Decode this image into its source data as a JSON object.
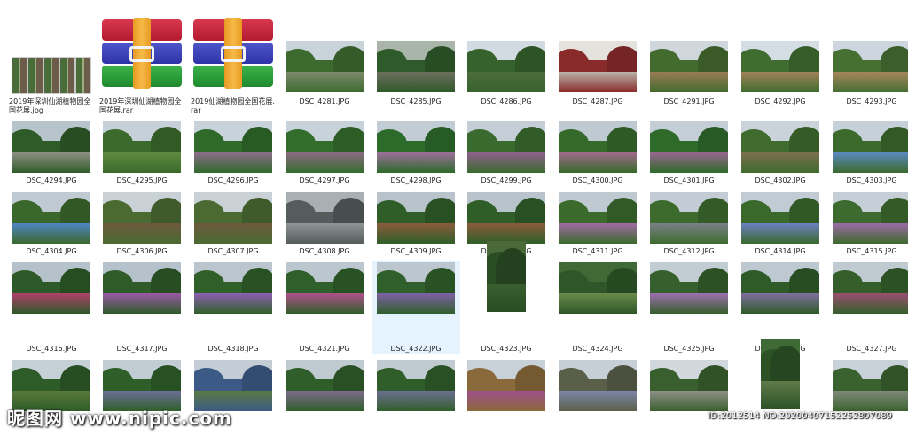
{
  "files": [
    {
      "type": "sheet",
      "name": "2019年深圳仙湖植物园全国花展.jpg"
    },
    {
      "type": "rar",
      "name": "2019年深圳仙湖植物园全国花展.rar"
    },
    {
      "type": "rar",
      "name": "2019仙湖植物园全国花展.rar"
    },
    {
      "type": "photo",
      "name": "DSC_4281.JPG",
      "sky": "#c9d3da",
      "tree": "#3d6b2f",
      "ground": "#7d8a6c"
    },
    {
      "type": "photo",
      "name": "DSC_4285.JPG",
      "sky": "#a9b5a8",
      "tree": "#2f5a2a",
      "ground": "#6e6f5e"
    },
    {
      "type": "photo",
      "name": "DSC_4286.JPG",
      "sky": "#d2dbe2",
      "tree": "#36632d",
      "ground": "#4f6d3c"
    },
    {
      "type": "photo",
      "name": "DSC_4287.JPG",
      "sky": "#e4e2dd",
      "tree": "#8a2b2b",
      "ground": "#b9b4aa"
    },
    {
      "type": "photo",
      "name": "DSC_4291.JPG",
      "sky": "#cfd6dc",
      "tree": "#446b2e",
      "ground": "#9b7c55"
    },
    {
      "type": "photo",
      "name": "DSC_4292.JPG",
      "sky": "#d5dde4",
      "tree": "#3f6c2f",
      "ground": "#a2815a"
    },
    {
      "type": "photo",
      "name": "DSC_4293.JPG",
      "sky": "#cdd6de",
      "tree": "#466f32",
      "ground": "#a8855c"
    },
    {
      "type": "photo",
      "name": "DSC_4294.JPG",
      "sky": "#b8c4cc",
      "tree": "#2f5b29",
      "ground": "#8d8f82"
    },
    {
      "type": "photo",
      "name": "DSC_4295.JPG",
      "sky": "#c5d0d8",
      "tree": "#3b6a2c",
      "ground": "#5f8a3e"
    },
    {
      "type": "photo",
      "name": "DSC_4296.JPG",
      "sky": "#c8d2da",
      "tree": "#2f6a2a",
      "ground": "#8c6d8a"
    },
    {
      "type": "photo",
      "name": "DSC_4297.JPG",
      "sky": "#c8d2da",
      "tree": "#336d2c",
      "ground": "#8b6a82"
    },
    {
      "type": "photo",
      "name": "DSC_4298.JPG",
      "sky": "#c2ccd4",
      "tree": "#2d6b2b",
      "ground": "#9c6f9a"
    },
    {
      "type": "photo",
      "name": "DSC_4299.JPG",
      "sky": "#c5ced6",
      "tree": "#3a6b2e",
      "ground": "#8e5f8c"
    },
    {
      "type": "photo",
      "name": "DSC_4300.JPG",
      "sky": "#bfc9d1",
      "tree": "#356a2b",
      "ground": "#a16a8a"
    },
    {
      "type": "photo",
      "name": "DSC_4301.JPG",
      "sky": "#c4ced6",
      "tree": "#2e6a2a",
      "ground": "#98678f"
    },
    {
      "type": "photo",
      "name": "DSC_4302.JPG",
      "sky": "#cad3da",
      "tree": "#3f6b2e",
      "ground": "#7b6f4e"
    },
    {
      "type": "photo",
      "name": "DSC_4303.JPG",
      "sky": "#c6d0d8",
      "tree": "#3c6a2d",
      "ground": "#5a8ac0"
    },
    {
      "type": "photo",
      "name": "DSC_4304.JPG",
      "sky": "#bfcad3",
      "tree": "#3a682c",
      "ground": "#4f86c2"
    },
    {
      "type": "photo",
      "name": "DSC_4306.JPG",
      "sky": "#c9d1d6",
      "tree": "#4a6a32",
      "ground": "#6e5a3e"
    },
    {
      "type": "photo",
      "name": "DSC_4307.JPG",
      "sky": "#c9d1d6",
      "tree": "#4a6a32",
      "ground": "#6e5a3e"
    },
    {
      "type": "photo",
      "name": "DSC_4308.JPG",
      "sky": "#a9b0b4",
      "tree": "#555c5c",
      "ground": "#8f9494"
    },
    {
      "type": "photo",
      "name": "DSC_4309.JPG",
      "sky": "#b8c3cb",
      "tree": "#2f5e29",
      "ground": "#8a5c3b"
    },
    {
      "type": "photo",
      "name": "DSC_4310.JPG",
      "sky": "#b8c3cb",
      "tree": "#2f5e29",
      "ground": "#8a5c3b"
    },
    {
      "type": "photo",
      "name": "DSC_4311.JPG",
      "sky": "#bfc9d1",
      "tree": "#3b6a2d",
      "ground": "#a26aa4"
    },
    {
      "type": "photo",
      "name": "DSC_4312.JPG",
      "sky": "#c3ccd4",
      "tree": "#3d6b2e",
      "ground": "#7b8088"
    },
    {
      "type": "photo",
      "name": "DSC_4314.JPG",
      "sky": "#c1cbd3",
      "tree": "#3a692c",
      "ground": "#6c7fc0"
    },
    {
      "type": "photo",
      "name": "DSC_4315.JPG",
      "sky": "#c6cfd7",
      "tree": "#3d6a2e",
      "ground": "#9d6aa6"
    },
    {
      "type": "photo",
      "name": "DSC_4316.JPG",
      "sky": "#b6c2cb",
      "tree": "#2d5a28",
      "ground": "#b0406a"
    },
    {
      "type": "photo",
      "name": "DSC_4317.JPG",
      "sky": "#b6c2cb",
      "tree": "#2f5b29",
      "ground": "#9a5aa8"
    },
    {
      "type": "photo",
      "name": "DSC_4318.JPG",
      "sky": "#bac5cd",
      "tree": "#30602a",
      "ground": "#8c5fb0"
    },
    {
      "type": "photo",
      "name": "DSC_4321.JPG",
      "sky": "#bcc6ce",
      "tree": "#2f5f2a",
      "ground": "#b0508a"
    },
    {
      "type": "photo",
      "name": "DSC_4322.JPG",
      "sky": "#bcc6ce",
      "tree": "#2f5f2a",
      "ground": "#7e60a6",
      "selected": true
    },
    {
      "type": "photo",
      "name": "DSC_4323.JPG",
      "sky": "#4b6a3a",
      "tree": "#2a4d24",
      "ground": "#3a5f2f",
      "portrait": true
    },
    {
      "type": "photo",
      "name": "DSC_4324.JPG",
      "sky": "#3f6a35",
      "tree": "#2e5628",
      "ground": "#6b8a4a"
    },
    {
      "type": "photo",
      "name": "DSC_4325.JPG",
      "sky": "#c2ccd3",
      "tree": "#355f2c",
      "ground": "#9d70b0"
    },
    {
      "type": "photo",
      "name": "DSC_4326.JPG",
      "sky": "#bec8d0",
      "tree": "#2f5b29",
      "ground": "#7f6f9e"
    },
    {
      "type": "photo",
      "name": "DSC_4327.JPG",
      "sky": "#c0cad1",
      "tree": "#345f2b",
      "ground": "#9a4f6e"
    },
    {
      "type": "photo",
      "name": "",
      "sky": "#c6d0d7",
      "tree": "#2d5c28",
      "ground": "#5a7a3c"
    },
    {
      "type": "photo",
      "name": "",
      "sky": "#c2ccd3",
      "tree": "#2f5f29",
      "ground": "#6c6f9a"
    },
    {
      "type": "photo",
      "name": "",
      "sky": "#c4cdd5",
      "tree": "#3b5a86",
      "ground": "#5a7a42"
    },
    {
      "type": "photo",
      "name": "",
      "sky": "#c0cad1",
      "tree": "#305e2a",
      "ground": "#7d6a8c"
    },
    {
      "type": "photo",
      "name": "",
      "sky": "#c0cad1",
      "tree": "#305e2a",
      "ground": "#6b6f92"
    },
    {
      "type": "photo",
      "name": "",
      "sky": "#c8d1d8",
      "tree": "#8a6a3a",
      "ground": "#a04f8a"
    },
    {
      "type": "photo",
      "name": "",
      "sky": "#c6cfd6",
      "tree": "#5a5f4a",
      "ground": "#7c86a8"
    },
    {
      "type": "photo",
      "name": "",
      "sky": "#d0d8de",
      "tree": "#3a5f2e",
      "ground": "#8f8f88"
    },
    {
      "type": "photo",
      "name": "",
      "sky": "#3f6a35",
      "tree": "#2c5226",
      "ground": "#5f7b4a",
      "portrait": true
    },
    {
      "type": "photo",
      "name": "",
      "sky": "#c8d1d8",
      "tree": "#3a622e",
      "ground": "#7f8a7a"
    }
  ],
  "watermark": {
    "site": "昵图网 www.nipic.com",
    "id": "ID:2012514 NO:20200407152252807089"
  }
}
